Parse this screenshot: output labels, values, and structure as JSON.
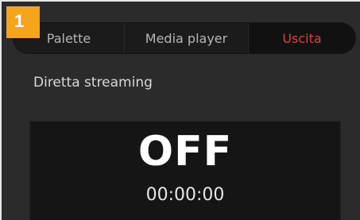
{
  "step_badge": "1",
  "tabs": [
    {
      "label": "Palette",
      "active": false
    },
    {
      "label": "Media player",
      "active": false
    },
    {
      "label": "Uscita",
      "active": true
    }
  ],
  "section": {
    "label": "Diretta streaming"
  },
  "streaming": {
    "status": "OFF",
    "time": "00:00:00"
  },
  "colors": {
    "badge": "#f4a51c",
    "active_tab_text": "#d9433a",
    "background": "#2b2b2b",
    "panel": "#151515"
  }
}
